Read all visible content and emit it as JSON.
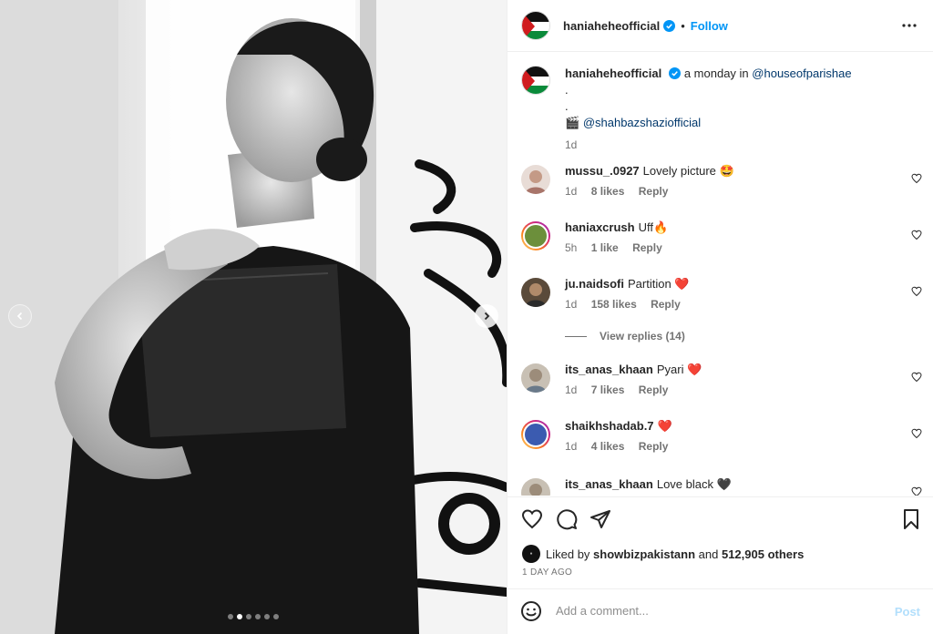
{
  "post": {
    "username": "haniaheheofficial",
    "follow_label": "Follow",
    "separator": "•",
    "caption_text": "a monday in",
    "caption_mention": "@houseofparishae",
    "caption_dot1": ".",
    "caption_dot2": ".",
    "caption_credit_icon": "🎬",
    "caption_credit": "@shahbazshaziofficial",
    "caption_time": "1d"
  },
  "comments": [
    {
      "user": "mussu_.0927",
      "text": "Lovely picture 🤩",
      "time": "1d",
      "likes": "8 likes",
      "reply": "Reply"
    },
    {
      "user": "haniaxcrush",
      "text": "Uff🔥",
      "time": "5h",
      "likes": "1 like",
      "reply": "Reply"
    },
    {
      "user": "ju.naidsofi",
      "text": "Partition ❤️",
      "time": "1d",
      "likes": "158 likes",
      "reply": "Reply"
    },
    {
      "user": "its_anas_khaan",
      "text": "Pyari ❤️",
      "time": "1d",
      "likes": "7 likes",
      "reply": "Reply"
    },
    {
      "user": "shaikhshadab.7",
      "text": "❤️",
      "time": "1d",
      "likes": "4 likes",
      "reply": "Reply"
    },
    {
      "user": "its_anas_khaan",
      "text": "Love black 🖤",
      "time": "",
      "likes": "",
      "reply": ""
    }
  ],
  "view_replies": "View replies (14)",
  "likes": {
    "prefix": "Liked by",
    "user": "showbizpakistann",
    "and": "and",
    "count": "512,905 others"
  },
  "time_ago": "1 DAY AGO",
  "add_comment": {
    "placeholder": "Add a comment...",
    "post_label": "Post"
  },
  "carousel": {
    "slide_count": 6,
    "active_index": 1
  },
  "icons": {
    "prev": "chevron-left-icon",
    "next": "chevron-right-icon",
    "more": "more-horizontal-icon",
    "like": "heart-icon",
    "comment": "comment-icon",
    "share": "send-icon",
    "save": "bookmark-icon",
    "emoji": "emoji-icon",
    "verified": "verified-badge-icon"
  },
  "colors": {
    "accent": "#0095f6",
    "mention": "#00376b",
    "muted": "#737373",
    "post_disabled": "#b2dffc"
  }
}
